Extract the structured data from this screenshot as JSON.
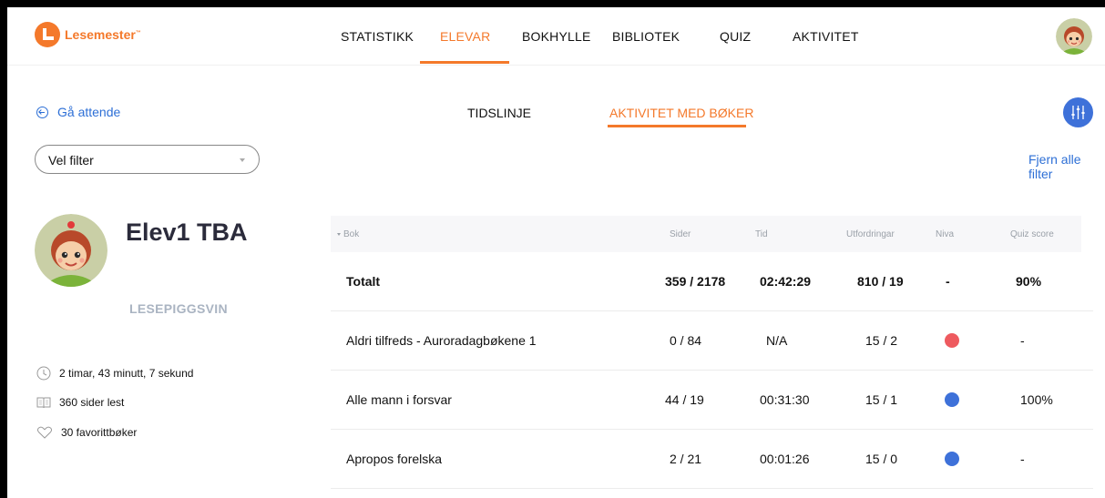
{
  "brand": {
    "name": "Lesemester",
    "mark": "™",
    "color": "#f4792b"
  },
  "nav": {
    "items": [
      {
        "label": "STATISTIKK",
        "active": false
      },
      {
        "label": "ELEVAR",
        "active": true
      },
      {
        "label": "BOKHYLLE",
        "active": false
      },
      {
        "label": "BIBLIOTEK",
        "active": false
      },
      {
        "label": "QUIZ",
        "active": false
      },
      {
        "label": "AKTIVITET",
        "active": false
      }
    ]
  },
  "back": {
    "label": "Gå attende",
    "icon": "back-arrow-circle-icon"
  },
  "tabs": [
    {
      "label": "TIDSLINJE",
      "active": false
    },
    {
      "label": "AKTIVITET MED BØKER",
      "active": true
    }
  ],
  "filter": {
    "value": "Vel filter"
  },
  "clear_filters": "Fjern alle filter",
  "student": {
    "name": "Elev1 TBA",
    "level": "LESEPIGGSVIN",
    "stats": [
      {
        "icon": "clock-icon",
        "text": "2 timar, 43 minutt, 7 sekund"
      },
      {
        "icon": "book-icon",
        "text": "360 sider lest"
      },
      {
        "icon": "heart-icon",
        "text": "30 favorittbøker"
      }
    ]
  },
  "table": {
    "columns": {
      "book": "Bok",
      "pages": "Sider",
      "time": "Tid",
      "challenges": "Utfordringar",
      "level": "Niva",
      "quiz": "Quiz score"
    },
    "total": {
      "book": "Totalt",
      "pages": "359 / 2178",
      "time": "02:42:29",
      "challenges": "810 / 19",
      "level": "-",
      "quiz": "90%"
    },
    "rows": [
      {
        "book": "Aldri tilfreds - Auroradagbøkene 1",
        "pages": "0 / 84",
        "time": "N/A",
        "challenges": "15 / 2",
        "level_color": "#ee5a5f",
        "quiz": "-"
      },
      {
        "book": "Alle mann i forsvar",
        "pages": "44 / 19",
        "time": "00:31:30",
        "challenges": "15 / 1",
        "level_color": "#3e71d9",
        "quiz": "100%"
      },
      {
        "book": "Apropos forelska",
        "pages": "2 / 21",
        "time": "00:01:26",
        "challenges": "15 / 0",
        "level_color": "#3e71d9",
        "quiz": "-"
      }
    ]
  },
  "colors": {
    "accent": "#f4792b",
    "link": "#2d6fd6",
    "button": "#3e71d9",
    "level_red": "#ee5a5f",
    "level_blue": "#3e71d9"
  }
}
